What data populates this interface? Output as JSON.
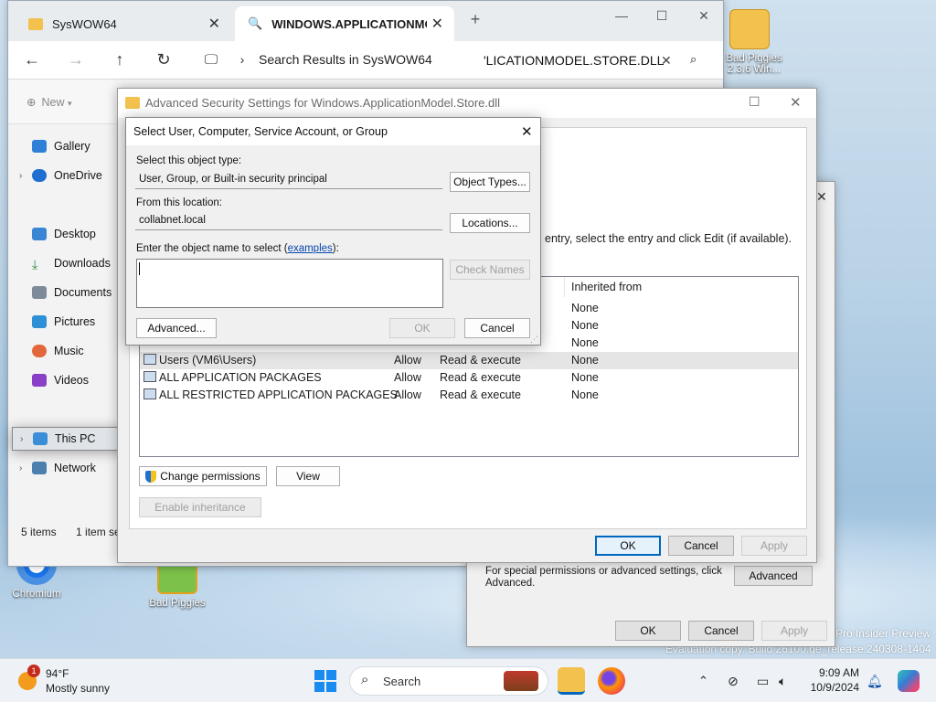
{
  "desktop": {
    "icons": [
      {
        "label": "Bad Piggies 2.3.6 Win..."
      },
      {
        "label": "Chromium"
      },
      {
        "label": "Bad Piggies"
      }
    ],
    "watermark_line1": "Pro Insider Preview",
    "watermark_line2": "Evaluation copy. Build 26100.ge_release.240308-1404"
  },
  "explorer": {
    "tabs": [
      {
        "label": "SysWOW64"
      },
      {
        "label": "WINDOWS.APPLICATIONMODE"
      }
    ],
    "breadcrumb": "Search Results in SysWOW64",
    "search_value": "'LICATIONMODEL.STORE.DLL",
    "new_label": "New",
    "nav": [
      {
        "label": "Gallery"
      },
      {
        "label": "OneDrive"
      },
      {
        "label": "Desktop"
      },
      {
        "label": "Downloads"
      },
      {
        "label": "Documents"
      },
      {
        "label": "Pictures"
      },
      {
        "label": "Music"
      },
      {
        "label": "Videos"
      },
      {
        "label": "This PC"
      },
      {
        "label": "Network"
      }
    ],
    "status_items": "5 items",
    "status_selected": "1 item se"
  },
  "properties": {
    "special_text": "For special permissions or advanced settings, click Advanced.",
    "advanced_label": "Advanced",
    "ok_label": "OK",
    "cancel_label": "Cancel",
    "apply_label": "Apply"
  },
  "advanced_security": {
    "title": "Advanced Security Settings for Windows.ApplicationModel.Store.dll",
    "instructions": "entry, select the entry and click Edit (if available).",
    "column_inherited": "Inherited from",
    "rows": [
      {
        "principal": "",
        "type": "",
        "access": "",
        "inherited": "None"
      },
      {
        "principal": "",
        "type": "",
        "access": "",
        "inherited": "None"
      },
      {
        "principal": "",
        "type": "",
        "access": "",
        "inherited": "None"
      },
      {
        "principal": "Users (VM6\\Users)",
        "type": "Allow",
        "access": "Read & execute",
        "inherited": "None"
      },
      {
        "principal": "ALL APPLICATION PACKAGES",
        "type": "Allow",
        "access": "Read & execute",
        "inherited": "None"
      },
      {
        "principal": "ALL RESTRICTED APPLICATION PACKAGES",
        "type": "Allow",
        "access": "Read & execute",
        "inherited": "None"
      }
    ],
    "change_permissions_label": "Change permissions",
    "view_label": "View",
    "enable_inheritance_label": "Enable inheritance",
    "ok_label": "OK",
    "cancel_label": "Cancel",
    "apply_label": "Apply"
  },
  "select_dialog": {
    "title": "Select User, Computer, Service Account, or Group",
    "object_type_label": "Select this object type:",
    "object_type_value": "User, Group, or Built-in security principal",
    "object_types_button": "Object Types...",
    "location_label": "From this location:",
    "location_value": "collabnet.local",
    "locations_button": "Locations...",
    "enter_label": "Enter the object name to select (",
    "examples_link": "examples",
    "enter_label_end": "):",
    "check_names_button": "Check Names",
    "advanced_button": "Advanced...",
    "ok_button": "OK",
    "cancel_button": "Cancel"
  },
  "taskbar": {
    "weather_temp": "94°F",
    "weather_desc": "Mostly sunny",
    "weather_badge": "1",
    "search_label": "Search",
    "time": "9:09 AM",
    "date": "10/9/2024"
  },
  "colors": {
    "accent": "#0067c0",
    "folder": "#f2c14e"
  }
}
